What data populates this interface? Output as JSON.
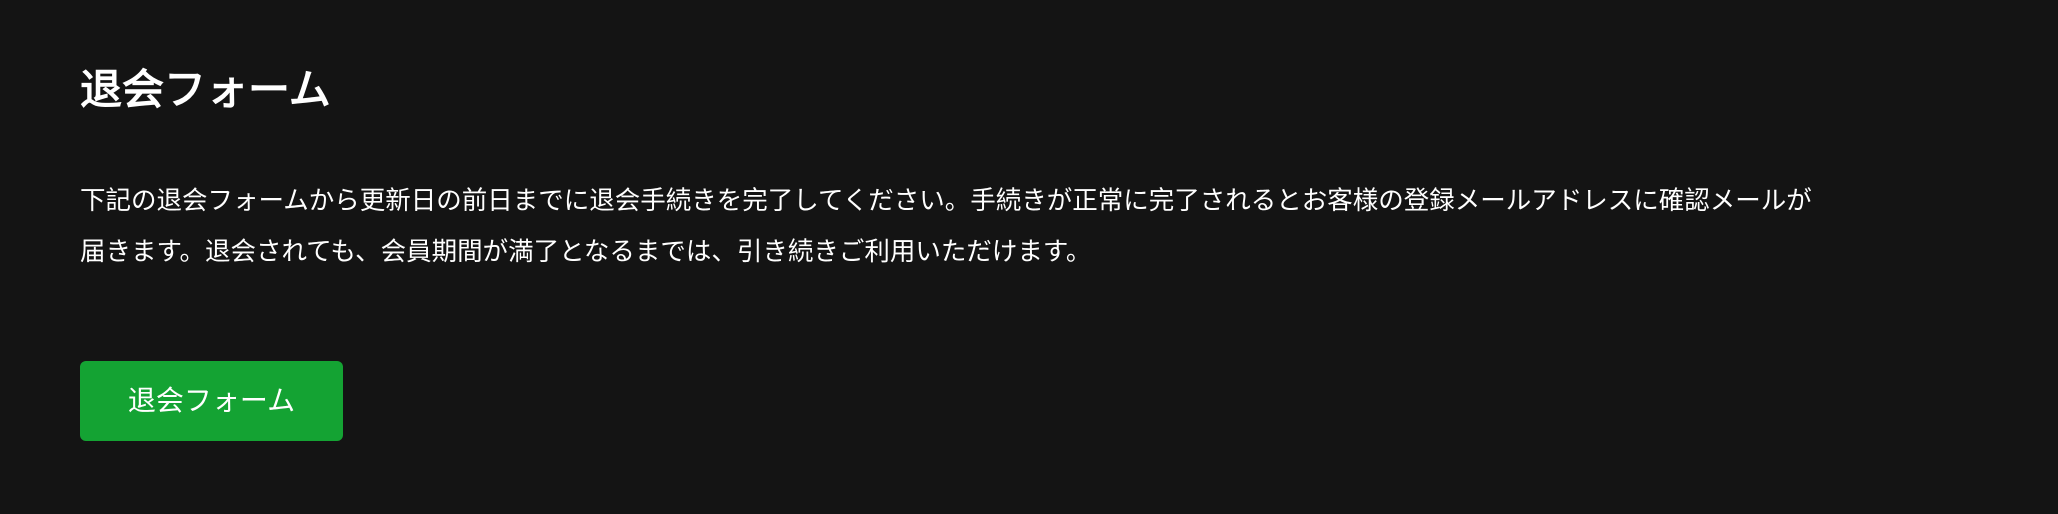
{
  "page": {
    "title": "退会フォーム",
    "description_line_1": "下記の退会フォームから更新日の前日までに退会手続きを完了してください。手続きが正常に完了されるとお客様の登録メールアドレスに確認メールが",
    "description_line_2": "届きます。退会されても、会員期間が満了となるまでは、引き続きご利用いただけます。",
    "button_label": "退会フォーム"
  },
  "colors": {
    "background": "#141414",
    "text": "#ffffff",
    "button": "#14a333"
  }
}
